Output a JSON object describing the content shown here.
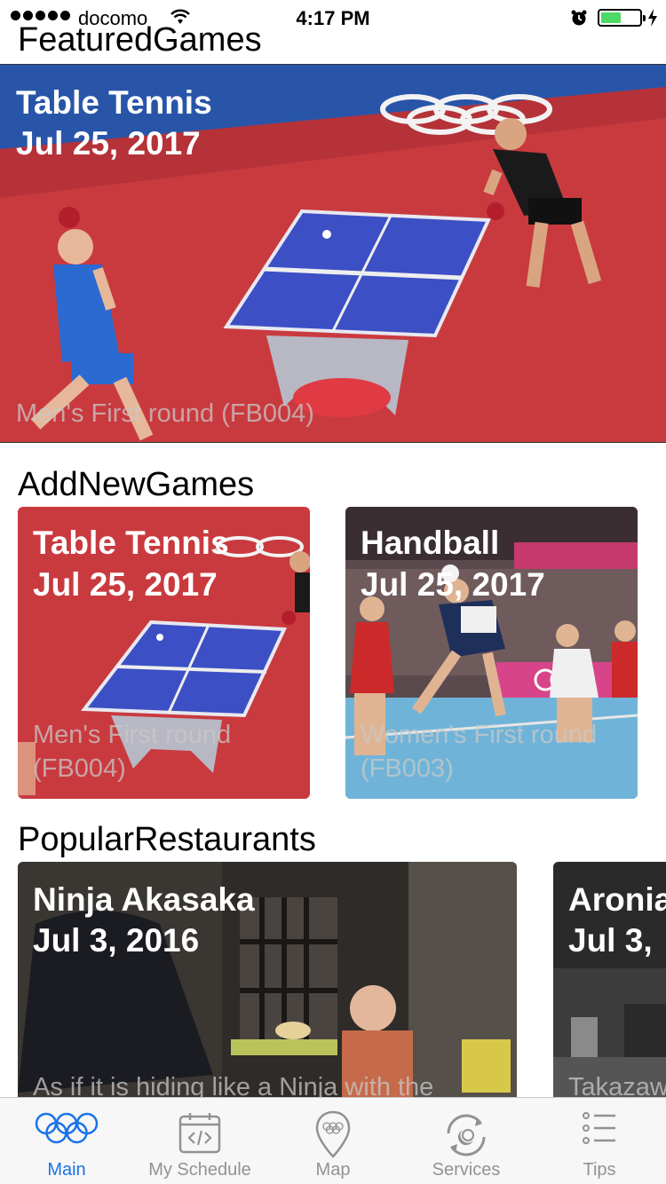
{
  "status_bar": {
    "carrier": "docomo",
    "time": "4:17 PM"
  },
  "featured": {
    "section_title": "FeaturedGames",
    "sport": "Table Tennis",
    "date": "Jul 25, 2017",
    "subtitle": "Men's First round (FB004)"
  },
  "add_new_games": {
    "section_title": "AddNewGames",
    "cards": [
      {
        "sport": "Table Tennis",
        "date": "Jul 25, 2017",
        "subtitle": "Men's First round (FB004)"
      },
      {
        "sport": "Handball",
        "date": "Jul 25, 2017",
        "subtitle": "Women's First round (FB003)"
      }
    ]
  },
  "popular_restaurants": {
    "section_title": "PopularRestaurants",
    "cards": [
      {
        "name": "Ninja Akasaka",
        "date": "Jul 3, 2016",
        "subtitle": "As if it is hiding like a Ninja with the"
      },
      {
        "name": "Aronia",
        "date": "Jul 3,",
        "subtitle": "Takazaw"
      }
    ]
  },
  "tab_bar": {
    "tabs": [
      {
        "label": "Main",
        "icon": "olympic-rings-icon",
        "active": true
      },
      {
        "label": "My Schedule",
        "icon": "calendar-code-icon",
        "active": false
      },
      {
        "label": "Map",
        "icon": "map-pin-icon",
        "active": false
      },
      {
        "label": "Services",
        "icon": "services-icon",
        "active": false
      },
      {
        "label": "Tips",
        "icon": "list-icon",
        "active": false
      }
    ]
  },
  "colors": {
    "accent": "#1a73e8",
    "court_red": "#c8323c",
    "table_blue": "#3a4fc2"
  }
}
